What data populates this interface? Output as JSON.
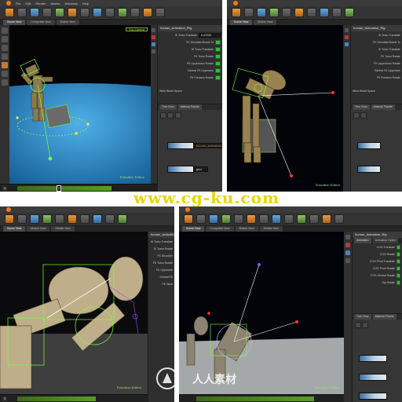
{
  "watermarks": {
    "top": "www.cg-ku.com",
    "bottom": "人人素材"
  },
  "colors": {
    "brand_orange": "#f07a1a",
    "rig_green": "#7cff3a",
    "ground_blue": "#1f7fc6",
    "ik_switch": "#37b83b"
  },
  "panel1": {
    "menu": [
      "File",
      "Edit",
      "Render",
      "Assets",
      "Windows",
      "Help"
    ],
    "tabs": [
      "Scene View",
      "Composite View",
      "Motion View"
    ],
    "viewport_chip": "Edu Camera",
    "edition_label": "Education Edition",
    "rig_panel": {
      "title": "human_animation_Rig",
      "rows": [
        {
          "label": "IK Torso Translate",
          "value": "0.47209"
        },
        {
          "label": "FK Shoulder/Grade To",
          "value": ""
        },
        {
          "label": "IK Torso Translate",
          "value": ""
        },
        {
          "label": "FK Torso Rotate",
          "value": ""
        },
        {
          "label": "FK Uppertorso Rotate",
          "value": ""
        },
        {
          "label": "Gimbal FK Upperarm",
          "value": ""
        },
        {
          "label": "FK Forearm Rotate",
          "value": ""
        }
      ],
      "space_label": "Wrist World Space",
      "sub_tabs": [
        "Tree View",
        "Material Palette"
      ],
      "name_field": "human_animation",
      "grid_label": "grid"
    },
    "timeline_frame": "1",
    "timeline_marker": "1"
  },
  "panel2": {
    "tabs": [
      "Scene View",
      "Motion View"
    ],
    "edition_label": "Education Edition",
    "rig_panel": {
      "title": "human_Animation_Rig",
      "rows": [
        {
          "label": "IK Torso Translate"
        },
        {
          "label": "FK Shoulder/Grade To"
        },
        {
          "label": "IK Torso Translate"
        },
        {
          "label": "FK Torso Rotate"
        },
        {
          "label": "FK Uppertorso Rotate"
        },
        {
          "label": "Gimbal FK Upperarm"
        },
        {
          "label": "FK Forearm Rotate"
        }
      ],
      "space_label": "Wrist World Space",
      "sub_tabs": [
        "Tree View",
        "Material Palette"
      ]
    }
  },
  "panel3": {
    "tabs": [
      "Scene View",
      "Motion View",
      "Details View"
    ],
    "edition_label": "Education Edition",
    "rig_panel": {
      "title": "human_animation_rig",
      "rows": [
        {
          "label": "IK Torso Translate"
        },
        {
          "label": "IK Torso Rotate"
        },
        {
          "label": "FK Shoulder"
        },
        {
          "label": "FK Torso Rotate"
        },
        {
          "label": "FK Upperarm"
        },
        {
          "label": "Gimbal FK"
        },
        {
          "label": "FK Wrist"
        }
      ]
    },
    "timeline_frame": "1"
  },
  "panel4": {
    "tabs": [
      "Scene View",
      "Composite View",
      "Motion View",
      "Details View"
    ],
    "edition_label": "Education Edition",
    "rig_panel": {
      "title": "human_Animation_Rig",
      "tabs": [
        "Animation",
        "Animation Option"
      ],
      "rows": [
        {
          "label": "COG Translate"
        },
        {
          "label": "COG Rotate"
        },
        {
          "label": "COG Pivot Translate"
        },
        {
          "label": "COG Pivot Rotate"
        },
        {
          "label": "COG Gimbal Rotate"
        },
        {
          "label": "Hip Rotate"
        }
      ],
      "sub_tabs": [
        "Tree View",
        "Material Palette"
      ]
    }
  }
}
